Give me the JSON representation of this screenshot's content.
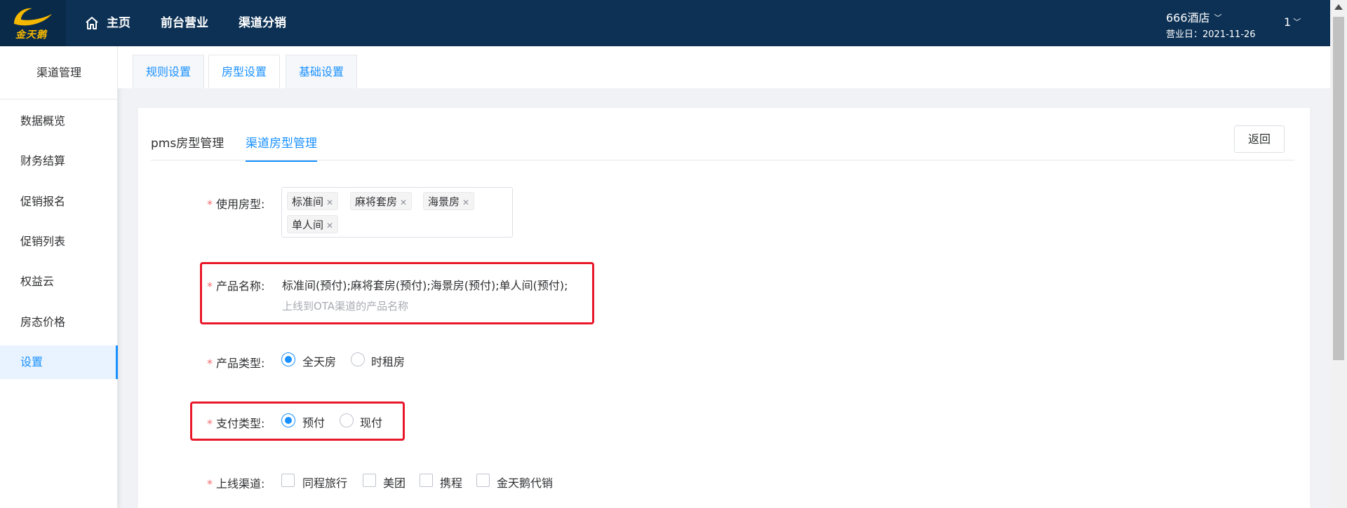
{
  "header": {
    "logo_text": "金天鹅",
    "nav": {
      "home": "主页",
      "front_desk": "前台营业",
      "channel": "渠道分销"
    },
    "hotel": "666酒店",
    "business_date": "营业日：2021-11-26",
    "user": "1"
  },
  "sidebar": {
    "title": "渠道管理",
    "items": [
      {
        "label": "数据概览"
      },
      {
        "label": "财务结算"
      },
      {
        "label": "促销报名"
      },
      {
        "label": "促销列表"
      },
      {
        "label": "权益云"
      },
      {
        "label": "房态价格"
      },
      {
        "label": "设置",
        "active": true
      }
    ]
  },
  "top_tabs": [
    {
      "label": "规则设置"
    },
    {
      "label": "房型设置",
      "active": true
    },
    {
      "label": "基础设置"
    }
  ],
  "sub_tabs": [
    {
      "label": "pms房型管理"
    },
    {
      "label": "渠道房型管理",
      "active": true
    }
  ],
  "back_label": "返回",
  "form": {
    "room_types": {
      "label": "使用房型:",
      "tags": [
        "标准间",
        "麻将套房",
        "海景房",
        "单人间"
      ]
    },
    "product_name": {
      "label": "产品名称:",
      "value": "标准间(预付);麻将套房(预付);海景房(预付);单人间(预付);",
      "hint": "上线到OTA渠道的产品名称"
    },
    "product_type": {
      "label": "产品类型:",
      "options": [
        "全天房",
        "时租房"
      ],
      "selected": "全天房"
    },
    "payment_type": {
      "label": "支付类型:",
      "options": [
        "预付",
        "现付"
      ],
      "selected": "预付"
    },
    "channels": {
      "label": "上线渠道:",
      "options": [
        "同程旅行",
        "美团",
        "携程",
        "金天鹅代销"
      ]
    }
  },
  "colors": {
    "header_bg": "#0c3155",
    "accent": "#1890ff",
    "highlight_box": "#e8182a",
    "required": "#f56c6c"
  }
}
